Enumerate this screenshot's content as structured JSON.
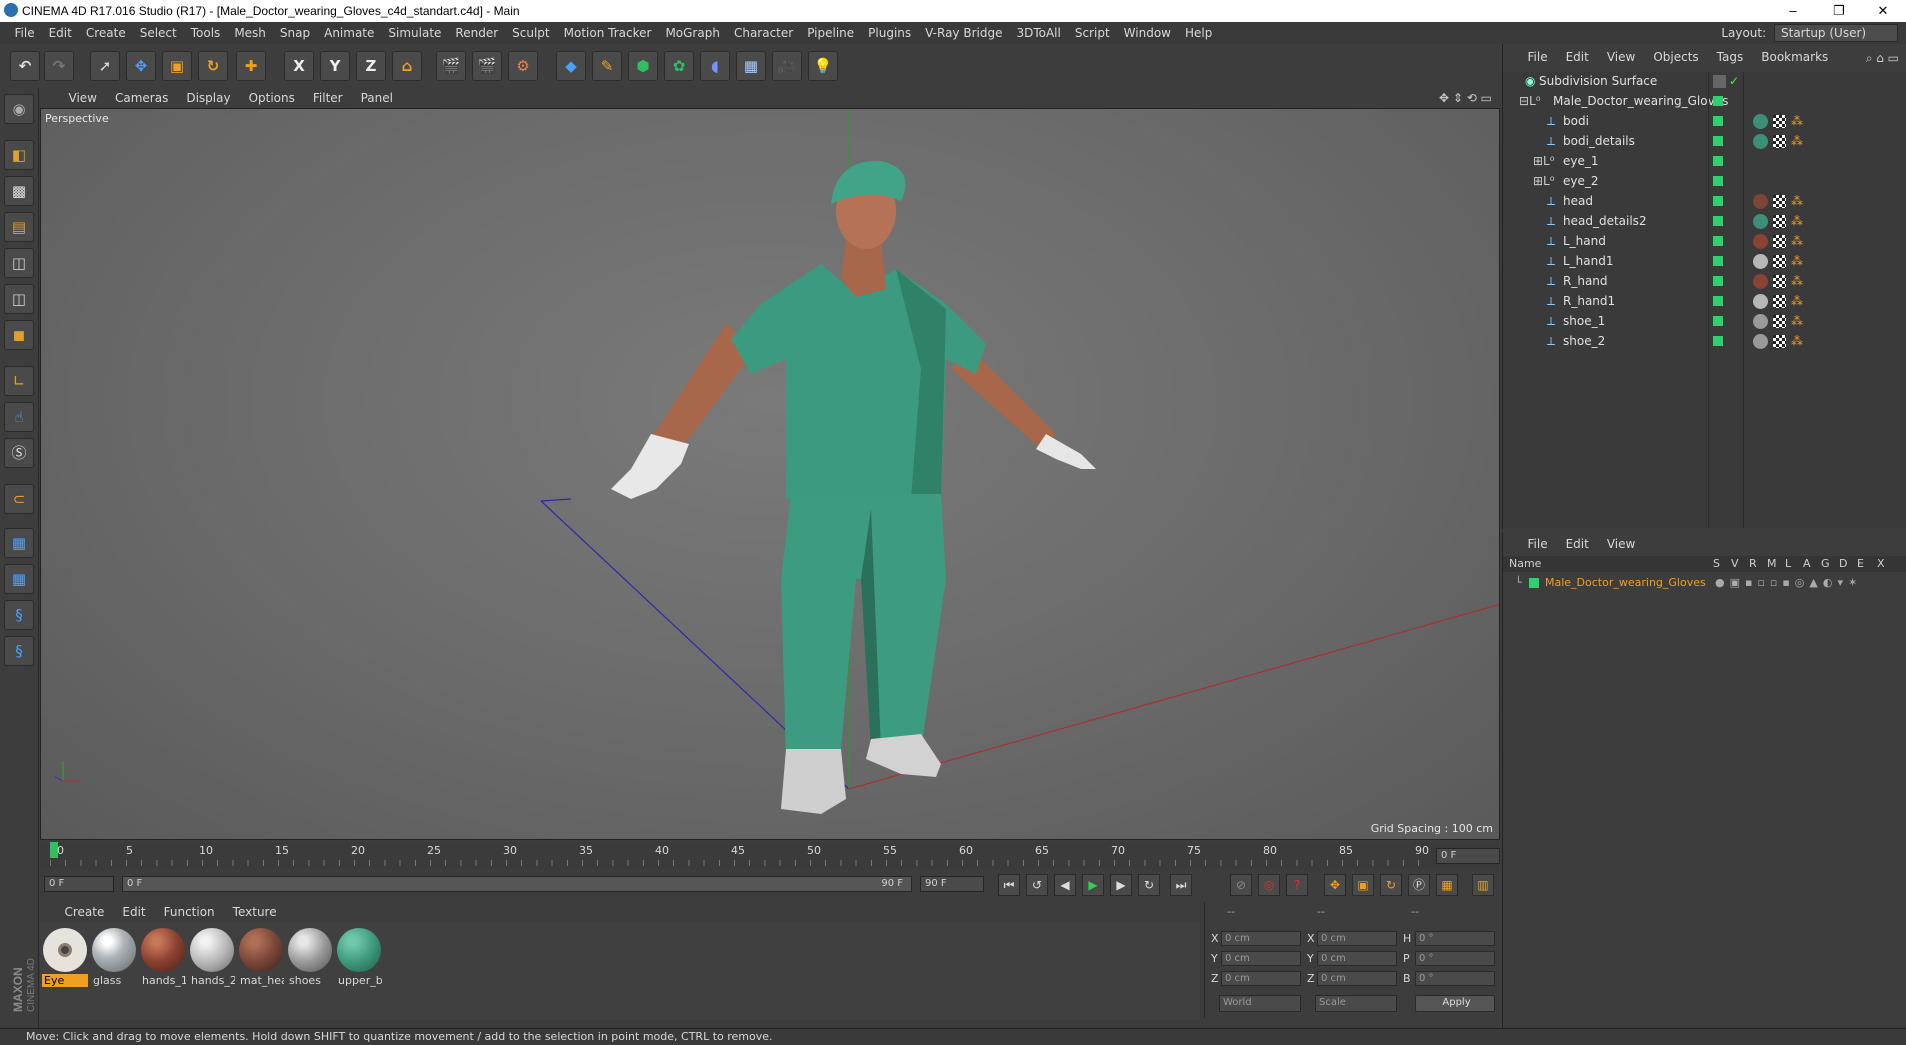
{
  "window": {
    "title": "CINEMA 4D R17.016 Studio (R17) - [Male_Doctor_wearing_Gloves_c4d_standart.c4d] - Main",
    "controls": [
      "–",
      "❐",
      "✕"
    ]
  },
  "menubar": {
    "items": [
      "File",
      "Edit",
      "Create",
      "Select",
      "Tools",
      "Mesh",
      "Snap",
      "Animate",
      "Simulate",
      "Render",
      "Sculpt",
      "Motion Tracker",
      "MoGraph",
      "Character",
      "Pipeline",
      "Plugins",
      "V-Ray Bridge",
      "3DToAll",
      "Script",
      "Window",
      "Help"
    ],
    "layout_label": "Layout:",
    "layout_value": "Startup (User)"
  },
  "toolbar": {
    "axis_x": "X",
    "axis_y": "Y",
    "axis_z": "Z"
  },
  "viewport": {
    "menu": [
      "View",
      "Cameras",
      "Display",
      "Options",
      "Filter",
      "Panel"
    ],
    "label": "Perspective",
    "grid_spacing": "Grid Spacing : 100 cm"
  },
  "timeline": {
    "ticks": [
      "0",
      "5",
      "10",
      "15",
      "20",
      "25",
      "30",
      "35",
      "40",
      "45",
      "50",
      "55",
      "60",
      "65",
      "70",
      "75",
      "80",
      "85",
      "90"
    ],
    "current_frame": "0 F",
    "start_field": "0 F",
    "range_start": "0 F",
    "range_end": "90 F",
    "end_field": "90 F"
  },
  "materials": {
    "menu": [
      "Create",
      "Edit",
      "Function",
      "Texture"
    ],
    "items": [
      {
        "name": "Eye",
        "color": "#c8c4bd",
        "selected": true
      },
      {
        "name": "glass",
        "color": "#9ea3a8",
        "selected": false
      },
      {
        "name": "hands_1",
        "color": "#8a4030",
        "selected": false
      },
      {
        "name": "hands_2",
        "color": "#b9b9b9",
        "selected": false
      },
      {
        "name": "mat_hea",
        "color": "#7a4638",
        "selected": false
      },
      {
        "name": "shoes",
        "color": "#9a9a9a",
        "selected": false
      },
      {
        "name": "upper_b",
        "color": "#3f9a7e",
        "selected": false
      }
    ]
  },
  "coords": {
    "headers": [
      "--",
      "--",
      "--"
    ],
    "rows": [
      {
        "l1": "X",
        "v1": "0 cm",
        "l2": "X",
        "v2": "0 cm",
        "l3": "H",
        "v3": "0 °"
      },
      {
        "l1": "Y",
        "v1": "0 cm",
        "l2": "Y",
        "v2": "0 cm",
        "l3": "P",
        "v3": "0 °"
      },
      {
        "l1": "Z",
        "v1": "0 cm",
        "l2": "Z",
        "v2": "0 cm",
        "l3": "B",
        "v3": "0 °"
      }
    ],
    "world": "World",
    "scale": "Scale",
    "apply": "Apply"
  },
  "objects_panel": {
    "menu": [
      "File",
      "Edit",
      "View",
      "Objects",
      "Tags",
      "Bookmarks"
    ],
    "items": [
      {
        "name": "Subdivision Surface",
        "level": 0
      },
      {
        "name": "Male_Doctor_wearing_Gloves",
        "level": 1
      },
      {
        "name": "bodi",
        "level": 2,
        "thumb": "#3c8f78"
      },
      {
        "name": "bodi_details",
        "level": 2,
        "thumb": "#3c8f78"
      },
      {
        "name": "eye_1",
        "level": 2
      },
      {
        "name": "eye_2",
        "level": 2
      },
      {
        "name": "head",
        "level": 2,
        "thumb": "#7c4636"
      },
      {
        "name": "head_details2",
        "level": 2,
        "thumb": "#3c8f78"
      },
      {
        "name": "L_hand",
        "level": 2,
        "thumb": "#8a4232"
      },
      {
        "name": "L_hand1",
        "level": 2,
        "thumb": "#b7b7b7"
      },
      {
        "name": "R_hand",
        "level": 2,
        "thumb": "#8a4232"
      },
      {
        "name": "R_hand1",
        "level": 2,
        "thumb": "#b7b7b7"
      },
      {
        "name": "shoe_1",
        "level": 2,
        "thumb": "#9a9a9a"
      },
      {
        "name": "shoe_2",
        "level": 2,
        "thumb": "#9a9a9a"
      }
    ]
  },
  "attributes_panel": {
    "menu": [
      "File",
      "Edit",
      "View"
    ],
    "columns": [
      "Name",
      "S",
      "V",
      "R",
      "M",
      "L",
      "A",
      "G",
      "D",
      "E",
      "X"
    ],
    "row": "Male_Doctor_wearing_Gloves"
  },
  "status": {
    "text": "Move: Click and drag to move elements. Hold down SHIFT to quantize movement / add to the selection in point mode, CTRL to remove."
  },
  "maxon_logo": "MAXON CINEMA 4D"
}
